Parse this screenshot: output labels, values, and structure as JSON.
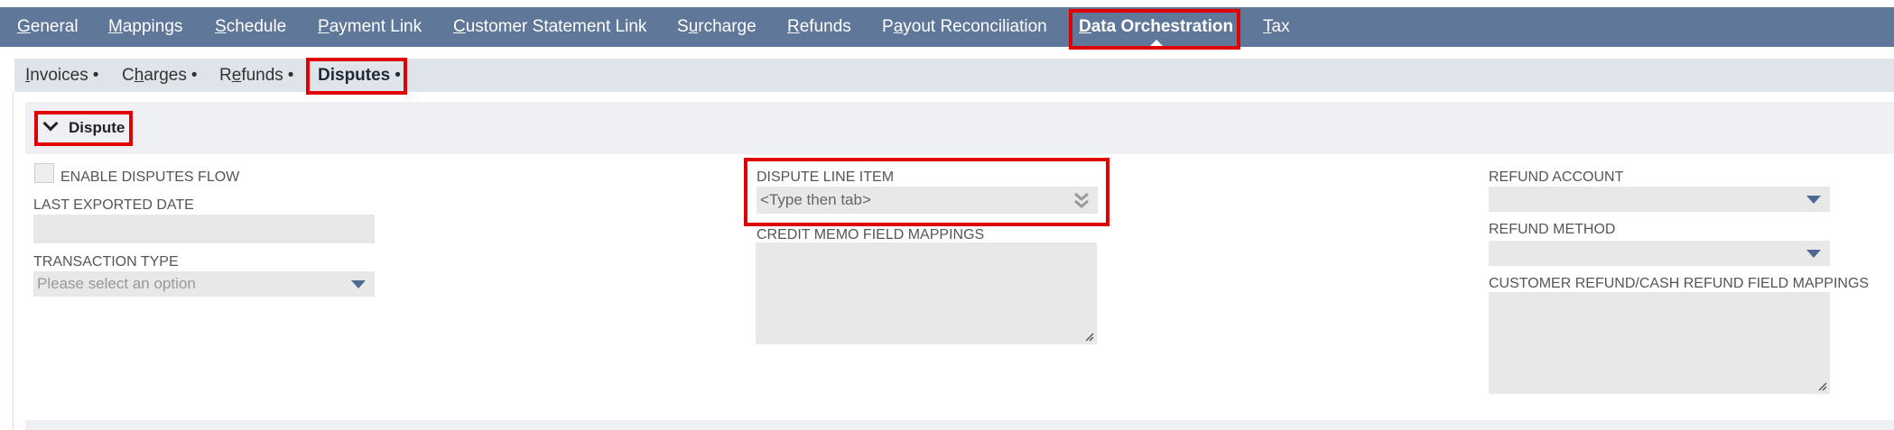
{
  "top_tabs": [
    {
      "hot": "G",
      "rest": "eneral"
    },
    {
      "hot": "M",
      "rest": "appings"
    },
    {
      "hot": "S",
      "rest": "chedule"
    },
    {
      "hot": "P",
      "rest": "ayment Link"
    },
    {
      "hot": "C",
      "rest": "ustomer Statement Link"
    },
    {
      "pre": "S",
      "hot": "u",
      "rest": "rcharge"
    },
    {
      "hot": "R",
      "rest": "efunds"
    },
    {
      "pre": "P",
      "hot": "a",
      "rest": "yout Reconciliation"
    },
    {
      "hot": "D",
      "rest": "ata Orchestration",
      "active": true
    },
    {
      "hot": "T",
      "rest": "ax"
    }
  ],
  "sub_tabs": [
    {
      "hot": "I",
      "rest": "nvoices",
      "dot": "•"
    },
    {
      "pre": "C",
      "hot": "h",
      "rest": "arges",
      "dot": "•"
    },
    {
      "pre": "R",
      "hot": "e",
      "rest": "funds",
      "dot": "•"
    },
    {
      "label": "Disputes",
      "dot": "•",
      "active": true
    }
  ],
  "section": {
    "title": "Dispute"
  },
  "form": {
    "enable_disputes_flow_label": "ENABLE DISPUTES FLOW",
    "enable_disputes_flow_checked": false,
    "last_exported_date_label": "LAST EXPORTED DATE",
    "last_exported_date_value": "",
    "transaction_type_label": "TRANSACTION TYPE",
    "transaction_type_placeholder": "Please select an option",
    "dispute_line_item_label": "DISPUTE LINE ITEM",
    "dispute_line_item_placeholder": "<Type then tab>",
    "credit_memo_field_mappings_label": "CREDIT MEMO FIELD MAPPINGS",
    "refund_account_label": "REFUND ACCOUNT",
    "refund_method_label": "REFUND METHOD",
    "customer_refund_mappings_label": "CUSTOMER REFUND/CASH REFUND FIELD MAPPINGS"
  },
  "colors": {
    "nav_bg": "#5f7799",
    "subnav_bg": "#dfe4eb",
    "highlight": "#e00000",
    "dropdown_arrow": "#4d6a93"
  }
}
